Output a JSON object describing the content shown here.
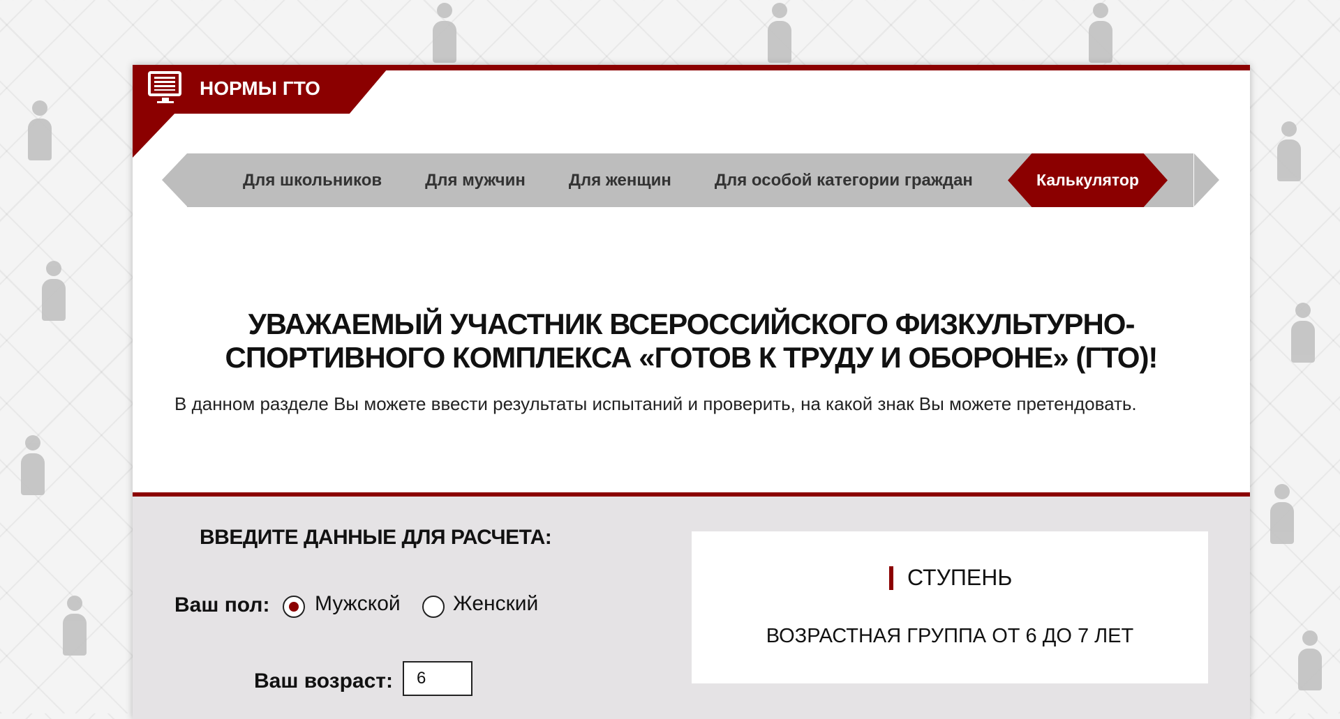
{
  "header": {
    "title": "НОРМЫ ГТО",
    "icon": "monitor-book-icon",
    "accent_color": "#8b0000"
  },
  "nav": {
    "items": [
      {
        "label": "Для школьников"
      },
      {
        "label": "Для мужчин"
      },
      {
        "label": "Для женщин"
      },
      {
        "label": "Для особой категории граждан"
      }
    ],
    "active_label": "Калькулятор"
  },
  "intro": {
    "headline_line1": "УВАЖАЕМЫЙ УЧАСТНИК ВСЕРОССИЙСКОГО ФИЗКУЛЬТУРНО-",
    "headline_line2": "СПОРТИВНОГО КОМПЛЕКСА «ГОТОВ К ТРУДУ И ОБОРОНЕ» (ГТО)!",
    "description": "В данном разделе Вы можете ввести результаты испытаний и проверить, на какой знак Вы можете претендовать."
  },
  "calculator": {
    "title": "ВВЕДИТЕ ДАННЫЕ ДЛЯ РАСЧЕТА:",
    "sex_label": "Ваш пол:",
    "sex_options": [
      {
        "label": "Мужской",
        "selected": true
      },
      {
        "label": "Женский",
        "selected": false
      }
    ],
    "age_label": "Ваш возраст:",
    "age_value": "6"
  },
  "result": {
    "stage_label": "СТУПЕНЬ",
    "age_group": "ВОЗРАСТНАЯ ГРУППА ОТ 6 ДО 7 ЛЕТ"
  }
}
